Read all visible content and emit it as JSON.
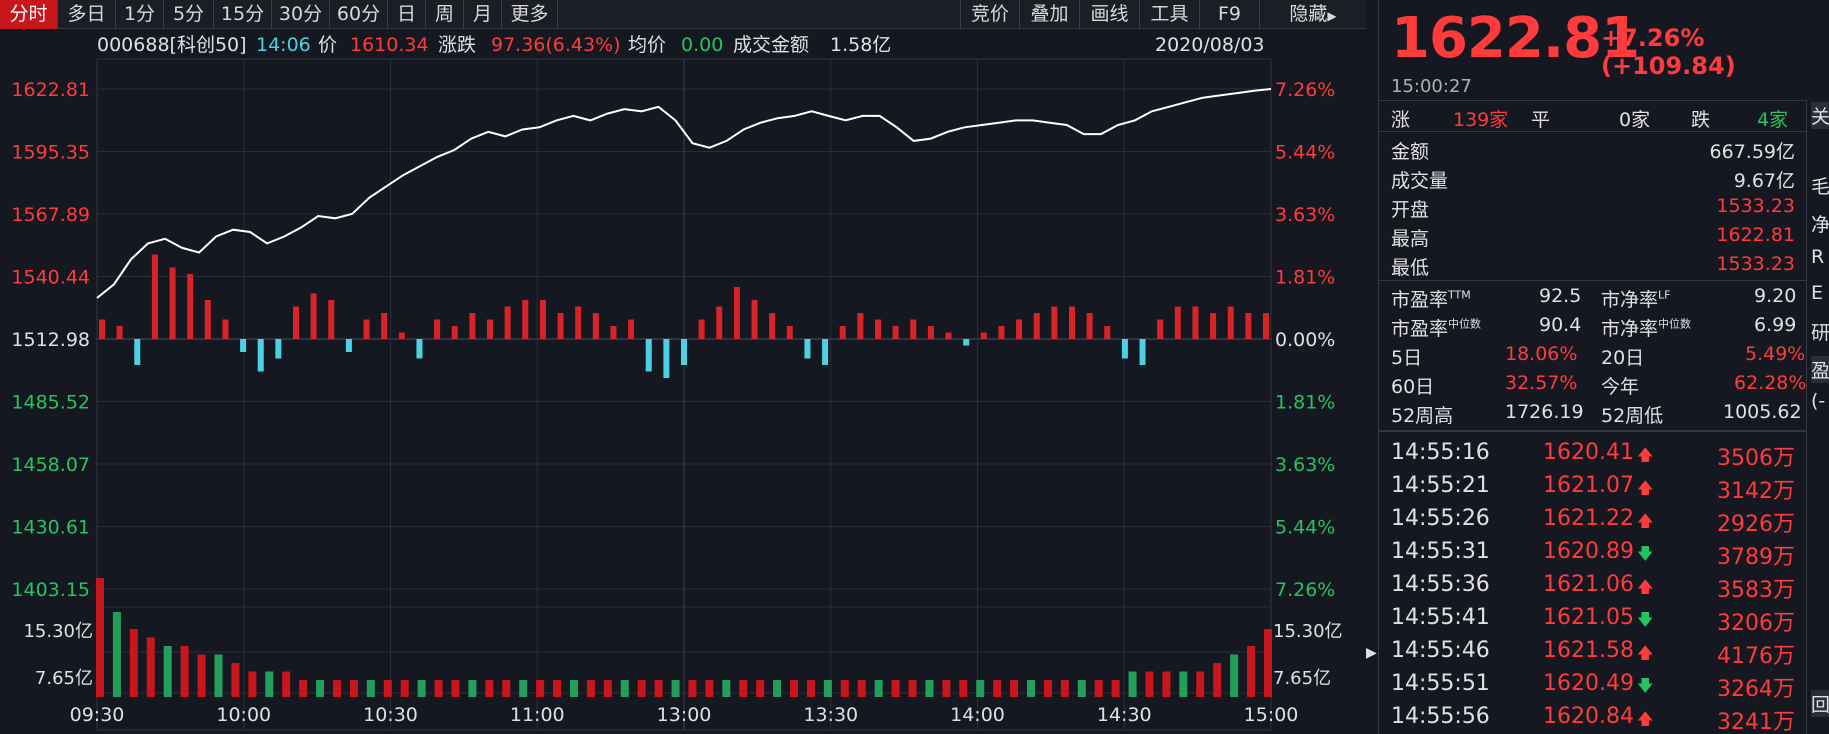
{
  "toolbar": {
    "tabs": [
      "分时",
      "多日",
      "1分",
      "5分",
      "15分",
      "30分",
      "60分",
      "日",
      "周",
      "月",
      "更多"
    ],
    "right_tabs": [
      "竞价",
      "叠加",
      "画线",
      "工具",
      "F9",
      "隐藏"
    ]
  },
  "info_bar": {
    "code": "000688[科创50]",
    "time": "14:06",
    "price_label": "价",
    "price": "1610.34",
    "change_label": "涨跌",
    "change": "97.36(6.43%)",
    "avg_label": "均价",
    "avg": "0.00",
    "amount_label": "成交金额",
    "amount": "1.58亿",
    "date": "2020/08/03"
  },
  "axes": {
    "left_price": [
      "1622.81",
      "1595.35",
      "1567.89",
      "1540.44",
      "1512.98",
      "1485.52",
      "1458.07",
      "1430.61",
      "1403.15"
    ],
    "right_pct": [
      "7.26%",
      "5.44%",
      "3.63%",
      "1.81%",
      "0.00%",
      "1.81%",
      "3.63%",
      "5.44%",
      "7.26%"
    ],
    "volume": [
      "15.30亿",
      "7.65亿"
    ],
    "times": [
      "09:30",
      "10:00",
      "10:30",
      "11:00",
      "13:00",
      "13:30",
      "14:00",
      "14:30",
      "15:00"
    ]
  },
  "colors": {
    "up": "#ff3b3b",
    "down": "#22c55e",
    "flat": "#e0e0e0",
    "line": "#ffffff",
    "cyan": "#4dd0e1"
  },
  "chart_data": {
    "type": "line",
    "price_range": [
      1403.15,
      1622.81
    ],
    "base": 1512.98,
    "times": [
      "09:30",
      "10:00",
      "10:30",
      "11:00",
      "13:00",
      "13:30",
      "14:00",
      "14:30",
      "15:00"
    ],
    "price": [
      1531,
      1537,
      1548,
      1555,
      1557,
      1553,
      1551,
      1558,
      1561,
      1560,
      1555,
      1558,
      1562,
      1567,
      1566,
      1568,
      1575,
      1580,
      1585,
      1589,
      1593,
      1596,
      1601,
      1604,
      1602,
      1605,
      1606,
      1609,
      1611,
      1609,
      1612,
      1614,
      1613,
      1615,
      1609,
      1599,
      1597,
      1600,
      1605,
      1608,
      1610,
      1611,
      1613,
      1611,
      1609,
      1611,
      1611,
      1606,
      1600,
      1601,
      1604,
      1606,
      1607,
      1608,
      1609,
      1609,
      1608,
      1607,
      1603,
      1603,
      1607,
      1609,
      1613,
      1615,
      1617,
      1619,
      1620,
      1621,
      1622,
      1622.81
    ],
    "bars": [
      3,
      2,
      -4,
      13,
      11,
      10,
      6,
      3,
      -2,
      -5,
      -3,
      5,
      7,
      6,
      -2,
      3,
      4,
      1,
      -3,
      3,
      2,
      4,
      3,
      5,
      6,
      6,
      4,
      5,
      4,
      2,
      3,
      -5,
      -6,
      -4,
      3,
      5,
      8,
      6,
      4,
      2,
      -3,
      -4,
      2,
      4,
      3,
      2,
      3,
      2,
      1,
      -1,
      1,
      2,
      3,
      4,
      5,
      5,
      4,
      2,
      -3,
      -4,
      3,
      5,
      5,
      4,
      5,
      4,
      4
    ],
    "volume": [
      14,
      10,
      8,
      7,
      6,
      6,
      5,
      5,
      4,
      3,
      3,
      3,
      2,
      2,
      2,
      2,
      2,
      2,
      2,
      2,
      2,
      2,
      2,
      2,
      2,
      2,
      2,
      2,
      2,
      2,
      2,
      2,
      2,
      2,
      2,
      2,
      2,
      2,
      2,
      2,
      2,
      2,
      2,
      2,
      2,
      2,
      2,
      2,
      2,
      2,
      2,
      2,
      2,
      2,
      2,
      2,
      2,
      2,
      2,
      2,
      2,
      3,
      3,
      3,
      3,
      3,
      4,
      5,
      6,
      8
    ]
  },
  "quote": {
    "price": "1622.81",
    "change": "+7.26% (+109.84)",
    "time": "15:00:27",
    "breadth": {
      "up_label": "涨",
      "up": "139家",
      "flat_label": "平",
      "flat": "0家",
      "down_label": "跌",
      "down": "4家"
    },
    "stats": [
      {
        "label": "金额",
        "value": "667.59亿",
        "color": "white"
      },
      {
        "label": "成交量",
        "value": "9.67亿",
        "color": "white"
      },
      {
        "label": "开盘",
        "value": "1533.23",
        "color": "red"
      },
      {
        "label": "最高",
        "value": "1622.81",
        "color": "red"
      },
      {
        "label": "最低",
        "value": "1533.23",
        "color": "red"
      }
    ],
    "pe": {
      "l1": "市盈率",
      "s1": "TTM",
      "v1": "92.5",
      "l2": "市净率",
      "s2": "LF",
      "v2": "9.20"
    },
    "pe2": {
      "l1": "市盈率",
      "s1": "中位数",
      "v1": "90.4",
      "l2": "市净率",
      "s2": "中位数",
      "v2": "6.99"
    },
    "perf1": {
      "l1": "5日",
      "v1": "18.06%",
      "l2": "20日",
      "v2": "5.49%"
    },
    "perf2": {
      "l1": "60日",
      "v1": "32.57%",
      "l2": "今年",
      "v2": "62.28%"
    },
    "w52": {
      "l1": "52周高",
      "v1": "1726.19",
      "l2": "52周低",
      "v2": "1005.62"
    }
  },
  "trades": [
    {
      "time": "14:55:16",
      "price": "1620.41",
      "dir": "up",
      "vol": "3506万"
    },
    {
      "time": "14:55:21",
      "price": "1621.07",
      "dir": "up",
      "vol": "3142万"
    },
    {
      "time": "14:55:26",
      "price": "1621.22",
      "dir": "up",
      "vol": "2926万"
    },
    {
      "time": "14:55:31",
      "price": "1620.89",
      "dir": "down",
      "vol": "3789万"
    },
    {
      "time": "14:55:36",
      "price": "1621.06",
      "dir": "up",
      "vol": "3583万"
    },
    {
      "time": "14:55:41",
      "price": "1621.05",
      "dir": "down",
      "vol": "3206万"
    },
    {
      "time": "14:55:46",
      "price": "1621.58",
      "dir": "up",
      "vol": "4176万"
    },
    {
      "time": "14:55:51",
      "price": "1620.49",
      "dir": "down",
      "vol": "3264万"
    },
    {
      "time": "14:55:56",
      "price": "1620.84",
      "dir": "up",
      "vol": "3241万"
    }
  ],
  "side": {
    "t1": "关",
    "t2": "毛",
    "t3": "净",
    "t4": "R",
    "t5": "E",
    "t6": "研",
    "t7": "盈",
    "t8": "(-",
    "t9": "回"
  }
}
